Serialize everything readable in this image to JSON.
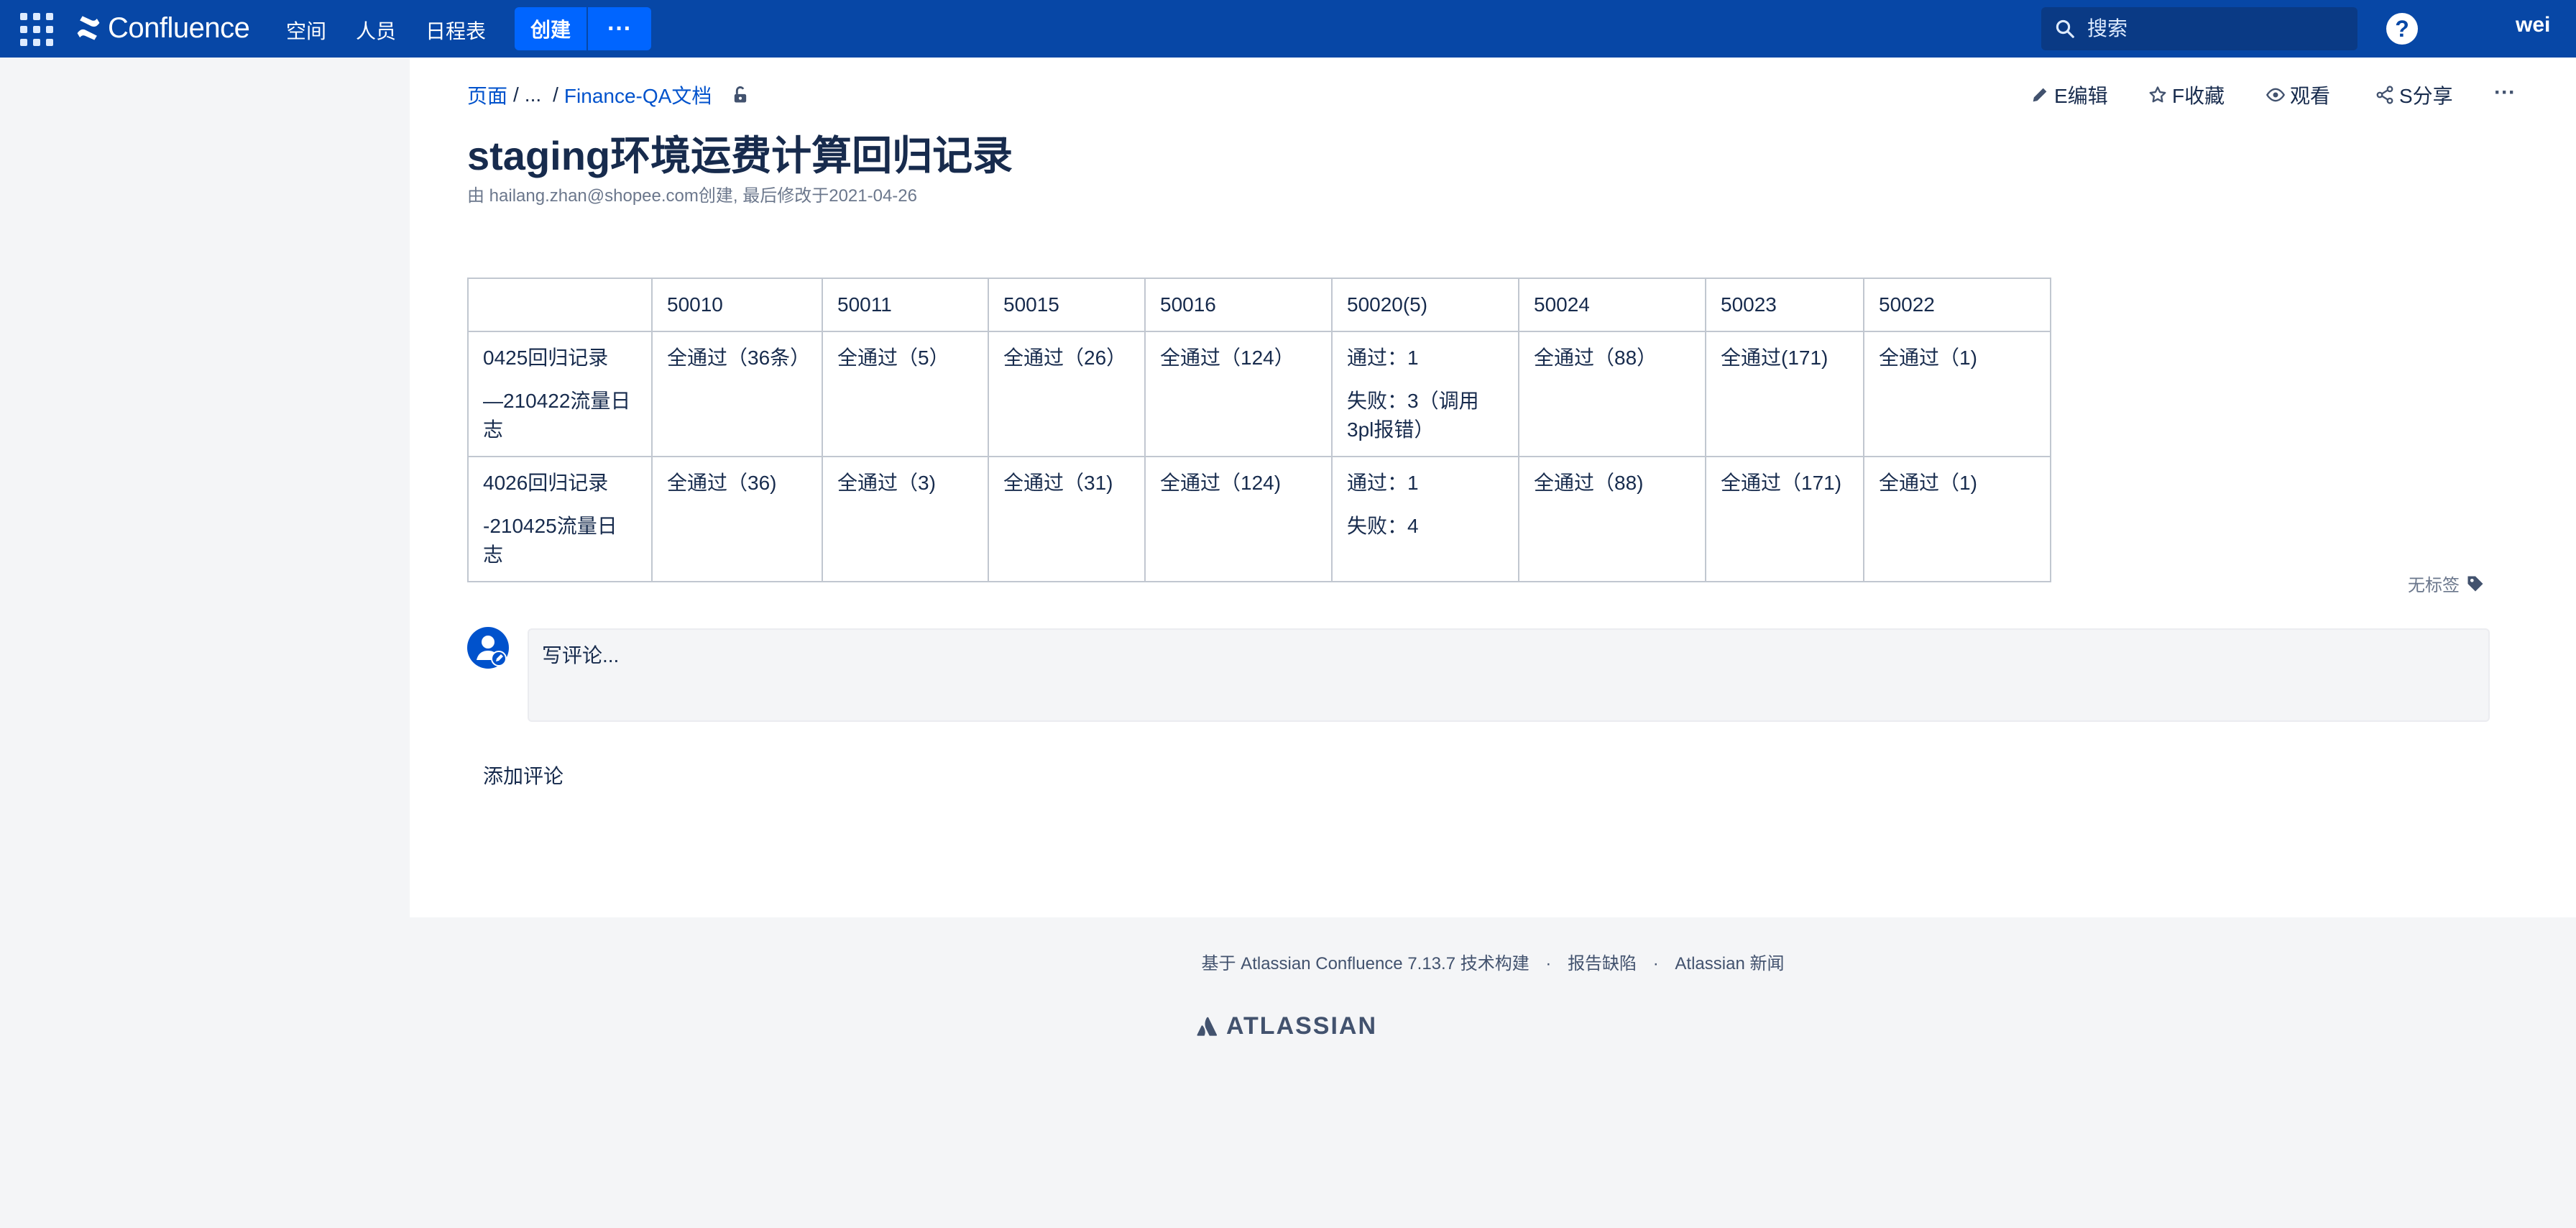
{
  "nav": {
    "brand": "Confluence",
    "links": [
      "空间",
      "人员",
      "日程表"
    ],
    "create_label": "创建",
    "more_label": "···",
    "search_placeholder": "搜索",
    "help_label": "?",
    "user": "wei"
  },
  "breadcrumb": {
    "pages": "页面",
    "sep1": "/",
    "ellipsis": "...",
    "sep2": "/",
    "parent": "Finance-QA文档"
  },
  "actions": {
    "edit": "E编辑",
    "favorite": "F收藏",
    "watch": "观看",
    "share": "S分享",
    "more": "···"
  },
  "page": {
    "title": "staging环境运费计算回归记录",
    "byline": "由 hailang.zhan@shopee.com创建, 最后修改于2021-04-26"
  },
  "table": {
    "headers": [
      "",
      "50010",
      "50011",
      "50015",
      "50016",
      "50020(5)",
      "50024",
      "50023",
      "50022"
    ],
    "rows": [
      {
        "label_line1": "0425回归记录",
        "label_line2": "—210422流量日志",
        "cells": [
          "全通过（36条）",
          "全通过（5）",
          "全通过（26）",
          "全通过（124）",
          "通过：1",
          "全通过（88）",
          "全通过(171)",
          "全通过（1)"
        ],
        "cell_extra": "失败：3（调用3pl报错）"
      },
      {
        "label_line1": "4026回归记录",
        "label_line2": "-210425流量日志",
        "cells": [
          "全通过（36)",
          "全通过（3)",
          "全通过（31)",
          "全通过（124)",
          "通过：1",
          "全通过（88)",
          "全通过（171)",
          "全通过（1)"
        ],
        "cell_extra": "失败：4"
      }
    ]
  },
  "labels": {
    "none": "无标签"
  },
  "comments": {
    "placeholder": "写评论...",
    "add": "添加评论"
  },
  "footer": {
    "built_with": "基于 Atlassian Confluence 7.13.7 技术构建",
    "dot1": "·",
    "report": "报告缺陷",
    "dot2": "·",
    "news": "Atlassian 新闻",
    "logo": "ATLASSIAN"
  },
  "colors": {
    "nav_bg": "#0747a6",
    "create_btn": "#0065ff",
    "link": "#0052cc",
    "text": "#172b4d",
    "muted": "#6b778c"
  }
}
